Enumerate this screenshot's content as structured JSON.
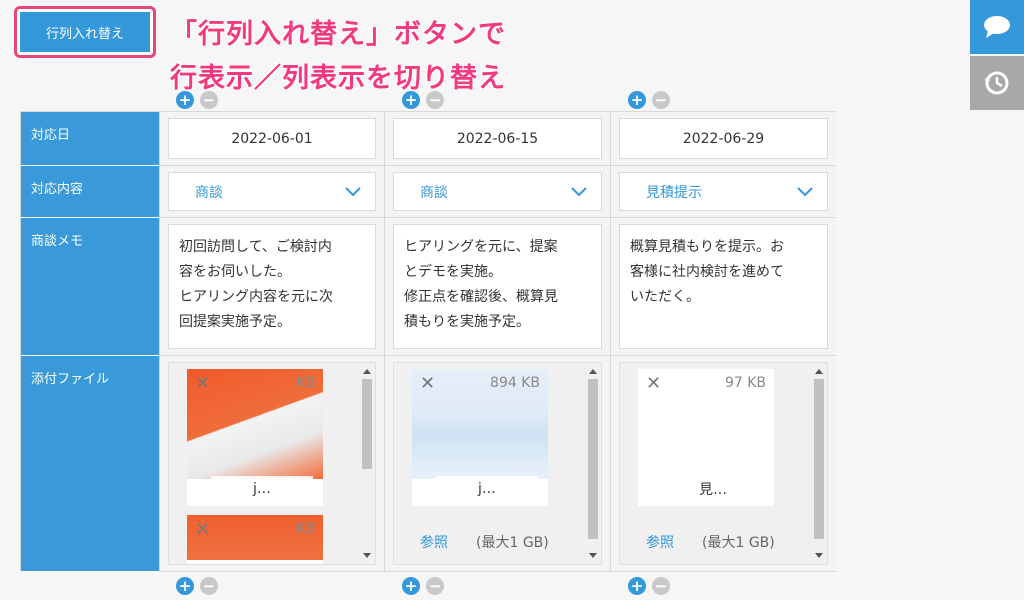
{
  "toolbar": {
    "swap_label": "行列入れ替え"
  },
  "annotation": {
    "line1": "「行列入れ替え」ボタンで",
    "line2": "行表示／列表示を切り替え"
  },
  "side": {
    "comment_icon": "comment-icon",
    "history_icon": "history-icon"
  },
  "controls": {
    "plus": "+",
    "minus": "−"
  },
  "rows": {
    "date_label": "対応日",
    "content_label": "対応内容",
    "memo_label": "商談メモ",
    "file_label": "添付ファイル"
  },
  "columns": [
    {
      "date": "2022-06-01",
      "content": "商談",
      "memo": [
        "初回訪問して、ご検討内",
        "容をお伺いした。",
        "ヒアリング内容を元に次",
        "回提案実施予定。"
      ],
      "file": {
        "size": "KB",
        "name": "j…"
      },
      "file2": {
        "size": "KB"
      }
    },
    {
      "date": "2022-06-15",
      "content": "商談",
      "memo": [
        "ヒアリングを元に、提案",
        "とデモを実施。",
        "修正点を確認後、概算見",
        "積もりを実施予定。"
      ],
      "file": {
        "size": "894 KB",
        "name": "j…"
      },
      "ref_label": "参照",
      "ref_note": "(最大1 GB)"
    },
    {
      "date": "2022-06-29",
      "content": "見積提示",
      "memo": [
        "概算見積もりを提示。お",
        "客様に社内検討を進めて",
        "いただく。"
      ],
      "file": {
        "size": "97 KB",
        "name": "見…"
      },
      "ref_label": "参照",
      "ref_note": "(最大1 GB)"
    }
  ],
  "colors": {
    "accent": "#3498db",
    "annotation": "#f23a7e",
    "header": "#3a9ad9"
  }
}
